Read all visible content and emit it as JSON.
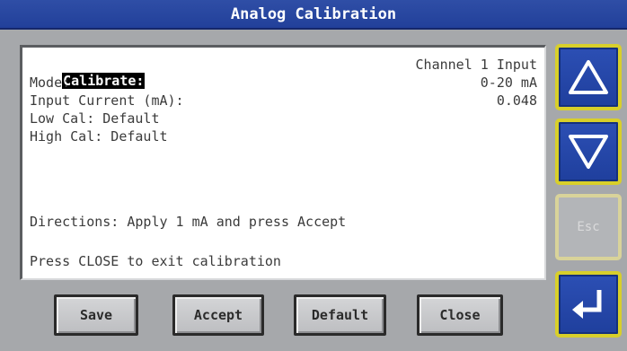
{
  "title": "Analog Calibration",
  "panel": {
    "calibrate_label": "Calibrate:",
    "channel_value": "Channel 1 Input",
    "mode_label": "Mode:",
    "mode_value": "0-20 mA",
    "input_current_label": "Input Current (mA):",
    "input_current_value": "0.048",
    "low_cal": "Low Cal: Default",
    "high_cal": "High Cal: Default",
    "directions": "Directions: Apply 1 mA and press Accept",
    "exit_hint": "Press CLOSE to exit calibration"
  },
  "side_buttons": {
    "esc_label": "Esc"
  },
  "bottom_buttons": {
    "save": "Save",
    "accept": "Accept",
    "default": "Default",
    "close": "Close"
  },
  "icons": {
    "up": "up-triangle-icon",
    "down": "down-triangle-icon",
    "enter": "enter-return-icon"
  },
  "colors": {
    "titlebar": "#22409a",
    "side_button": "#1f3f9d",
    "button_border_accent": "#d8cf2a"
  }
}
